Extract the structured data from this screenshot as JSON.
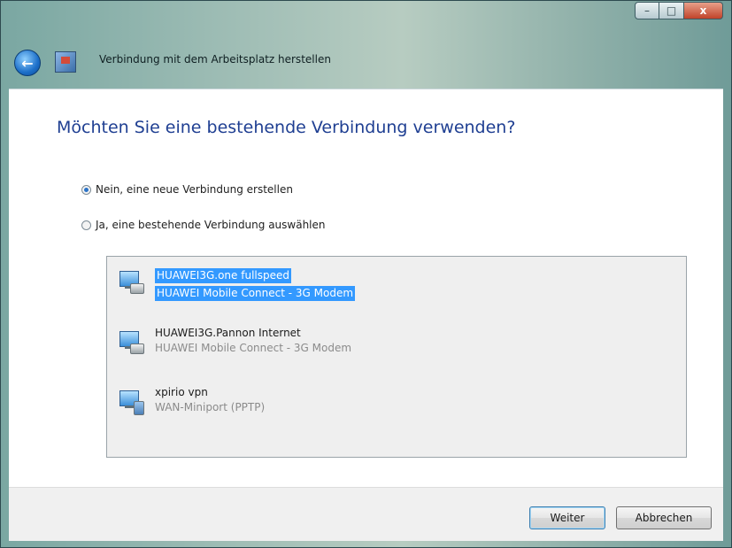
{
  "window": {
    "title": "Verbindung mit dem Arbeitsplatz herstellen",
    "buttons": {
      "minimize": "–",
      "maximize": "□",
      "close": "x"
    },
    "back_glyph": "←"
  },
  "heading": "Möchten Sie eine bestehende Verbindung verwenden?",
  "options": [
    {
      "label": "Nein, eine neue Verbindung erstellen",
      "checked": true
    },
    {
      "label": "Ja, eine bestehende Verbindung auswählen",
      "checked": false
    }
  ],
  "connections": [
    {
      "name": "HUAWEI3G.one fullspeed",
      "device": "HUAWEI Mobile Connect - 3G Modem",
      "icon": "modem-connection-icon",
      "selected": true
    },
    {
      "name": "HUAWEI3G.Pannon Internet",
      "device": "HUAWEI Mobile Connect - 3G Modem",
      "icon": "modem-connection-icon",
      "selected": false
    },
    {
      "name": "xpirio vpn",
      "device": "WAN-Miniport (PPTP)",
      "icon": "vpn-connection-icon",
      "selected": false
    }
  ],
  "footer": {
    "next_label": "Weiter",
    "cancel_label": "Abbrechen"
  },
  "colors": {
    "heading": "#1f3f92",
    "selection": "#3399ff",
    "muted_text": "#8b8b8b"
  }
}
